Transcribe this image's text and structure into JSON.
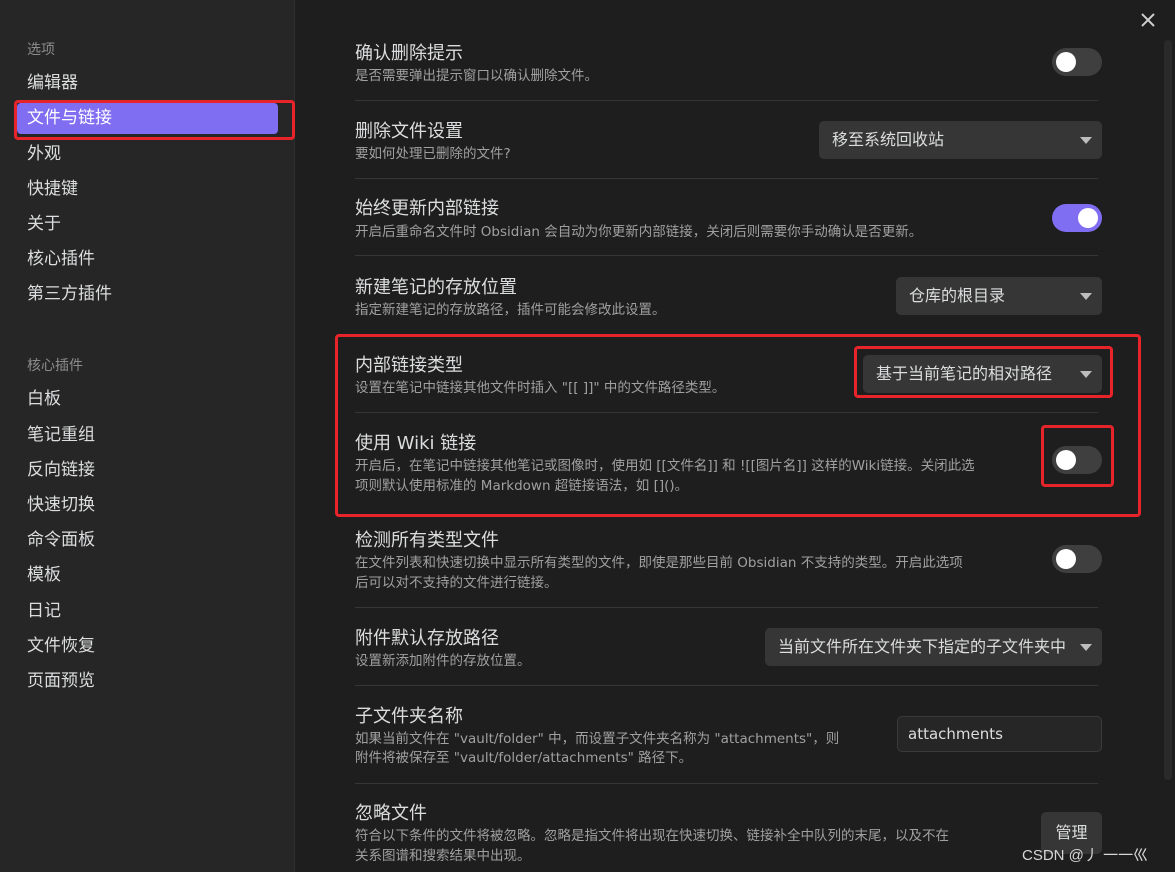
{
  "sidebar": {
    "options_title": "选项",
    "options": [
      "编辑器",
      "文件与链接",
      "外观",
      "快捷键",
      "关于",
      "核心插件",
      "第三方插件"
    ],
    "active_option": "文件与链接",
    "plugins_title": "核心插件",
    "plugins": [
      "白板",
      "笔记重组",
      "反向链接",
      "快速切换",
      "命令面板",
      "模板",
      "日记",
      "文件恢复",
      "页面预览"
    ]
  },
  "settings": {
    "confirm_delete": {
      "name": "确认删除提示",
      "desc": "是否需要弹出提示窗口以确认删除文件。",
      "enabled": false
    },
    "delete_files": {
      "name": "删除文件设置",
      "desc": "要如何处理已删除的文件?",
      "value": "移至系统回收站"
    },
    "update_links": {
      "name": "始终更新内部链接",
      "desc": "开启后重命名文件时 Obsidian 会自动为你更新内部链接，关闭后则需要你手动确认是否更新。",
      "enabled": true
    },
    "new_note_location": {
      "name": "新建笔记的存放位置",
      "desc": "指定新建笔记的存放路径，插件可能会修改此设置。",
      "value": "仓库的根目录"
    },
    "link_format": {
      "name": "内部链接类型",
      "desc": "设置在笔记中链接其他文件时插入 \"[[ ]]\" 中的文件路径类型。",
      "value": "基于当前笔记的相对路径"
    },
    "wiki_links": {
      "name": "使用 Wiki 链接",
      "desc_line1": "开启后，在笔记中链接其他笔记或图像时，使用如 [[文件名]] 和 ![[图片名]] 这样的Wiki链接。关闭此选",
      "desc_line2": "项则默认使用标准的 Markdown 超链接语法，如 []()。",
      "enabled": false
    },
    "detect_all_types": {
      "name": "检测所有类型文件",
      "desc_line1": "在文件列表和快速切换中显示所有类型的文件，即使是那些目前 Obsidian 不支持的类型。开启此选项",
      "desc_line2": "后可以对不支持的文件进行链接。",
      "enabled": false
    },
    "attachment_path": {
      "name": "附件默认存放路径",
      "desc": "设置新添加附件的存放位置。",
      "value": "当前文件所在文件夹下指定的子文件夹中"
    },
    "subfolder_name": {
      "name": "子文件夹名称",
      "desc_line1": "如果当前文件在 \"vault/folder\" 中，而设置子文件夹名称为 \"attachments\"，则",
      "desc_line2": "附件将被保存至 \"vault/folder/attachments\" 路径下。",
      "value": "attachments"
    },
    "ignore_files": {
      "name": "忽略文件",
      "desc_line1": "符合以下条件的文件将被忽略。忽略是指文件将出现在快速切换、链接补全中队列的末尾，以及不在",
      "desc_line2": "关系图谱和搜索结果中出现。",
      "button": "管理"
    }
  },
  "watermark": "CSDN @丿 一一巛",
  "colors": {
    "accent": "#7f6df2",
    "highlight": "#e8242b"
  },
  "icons": {
    "close": "close-icon",
    "dropdown": "chevron-down-icon"
  }
}
